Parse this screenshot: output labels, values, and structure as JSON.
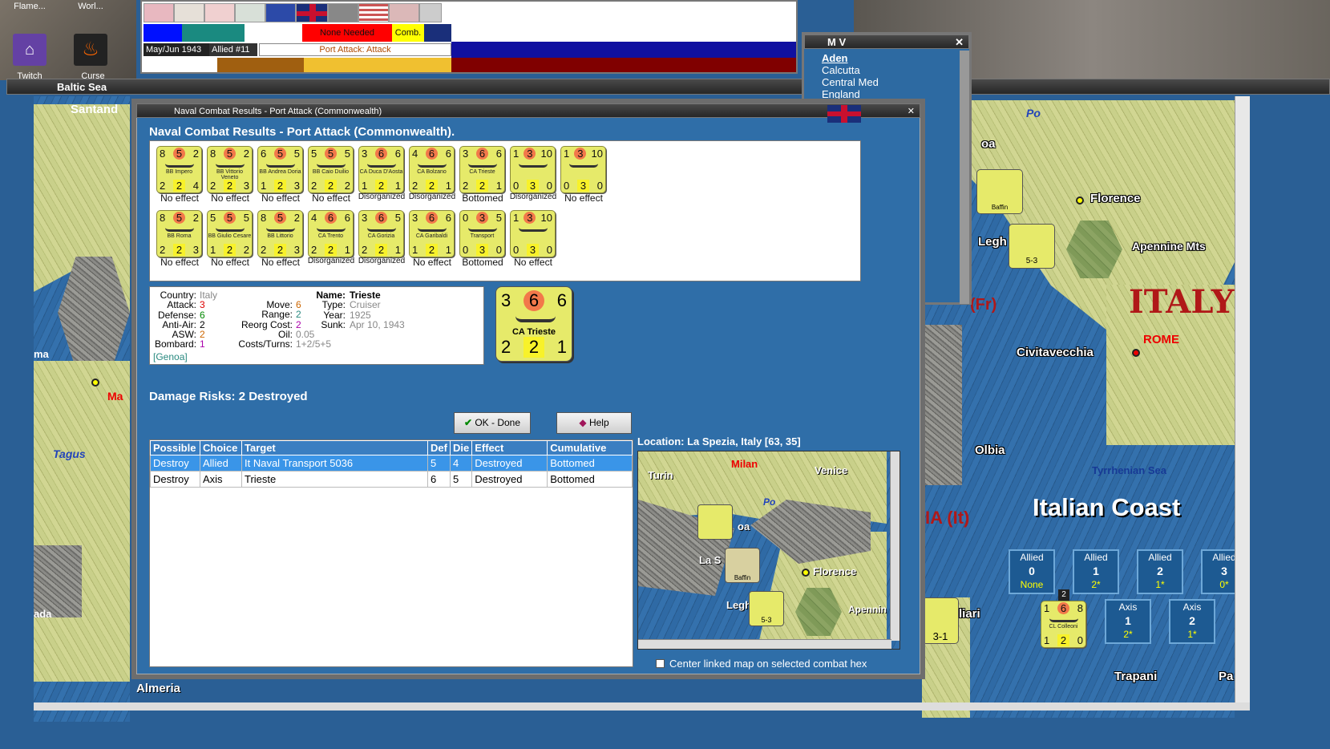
{
  "desktop": {
    "icons": [
      {
        "label": "Flame..."
      },
      {
        "label": "Worl..."
      },
      {
        "label": "Twitch"
      },
      {
        "label": "Curse Client"
      }
    ]
  },
  "top_bar": {
    "status_none": "None Needed",
    "status_comb": "Comb.",
    "date": "May/Jun 1943",
    "turn": "Allied #11",
    "phase": "Port Attack: Attack"
  },
  "mv_window": {
    "title": "M V",
    "items": [
      "Aden",
      "Calcutta",
      "Central Med",
      "England"
    ]
  },
  "baltic_window": {
    "title": "Baltic Sea"
  },
  "left_map": {
    "labels": [
      "Santand",
      "Tagus",
      "Ma",
      "ma",
      "ada",
      "Almeria"
    ]
  },
  "dialog": {
    "window_title": "Naval Combat Results - Port Attack (Commonwealth)",
    "header": "Naval Combat Results - Port Attack (Commonwealth).",
    "row1": [
      {
        "a": "8",
        "b": "5",
        "c": "2",
        "d": "2",
        "e": "2",
        "f": "4",
        "name": "BB Impero",
        "result": "No effect"
      },
      {
        "a": "8",
        "b": "5",
        "c": "2",
        "d": "2",
        "e": "2",
        "f": "3",
        "name": "BB Vittorio Veneto",
        "result": "No effect"
      },
      {
        "a": "6",
        "b": "5",
        "c": "5",
        "d": "1",
        "e": "2",
        "f": "3",
        "name": "BB Andrea Doria",
        "result": "No effect"
      },
      {
        "a": "5",
        "b": "5",
        "c": "5",
        "d": "2",
        "e": "2",
        "f": "2",
        "name": "BB Caio Duilio",
        "result": "No effect"
      },
      {
        "a": "3",
        "b": "6",
        "c": "6",
        "d": "1",
        "e": "2",
        "f": "1",
        "name": "CA Duca D'Aosta",
        "result": "Disorganized"
      },
      {
        "a": "4",
        "b": "6",
        "c": "6",
        "d": "2",
        "e": "2",
        "f": "1",
        "name": "CA Bolzano",
        "result": "Disorganized"
      },
      {
        "a": "3",
        "b": "6",
        "c": "6",
        "d": "2",
        "e": "2",
        "f": "1",
        "name": "CA Trieste",
        "result": "Bottomed"
      },
      {
        "a": "1",
        "b": "3",
        "c": "10",
        "d": "0",
        "e": "3",
        "f": "0",
        "name": "",
        "result": "Disorganized"
      },
      {
        "a": "1",
        "b": "3",
        "c": "10",
        "d": "0",
        "e": "3",
        "f": "0",
        "name": "",
        "result": "No effect"
      }
    ],
    "row2": [
      {
        "a": "8",
        "b": "5",
        "c": "2",
        "d": "2",
        "e": "2",
        "f": "3",
        "name": "BB Roma",
        "result": "No effect"
      },
      {
        "a": "5",
        "b": "5",
        "c": "5",
        "d": "1",
        "e": "2",
        "f": "2",
        "name": "BB Giulio Cesare",
        "result": "No effect"
      },
      {
        "a": "8",
        "b": "5",
        "c": "2",
        "d": "2",
        "e": "2",
        "f": "3",
        "name": "BB Littorio",
        "result": "No effect"
      },
      {
        "a": "4",
        "b": "6",
        "c": "6",
        "d": "2",
        "e": "2",
        "f": "1",
        "name": "CA Trento",
        "result": "Disorganized"
      },
      {
        "a": "3",
        "b": "6",
        "c": "5",
        "d": "2",
        "e": "2",
        "f": "1",
        "name": "CA Gorizia",
        "result": "Disorganized"
      },
      {
        "a": "3",
        "b": "6",
        "c": "6",
        "d": "1",
        "e": "2",
        "f": "1",
        "name": "CA Garibaldi",
        "result": "No effect"
      },
      {
        "a": "0",
        "b": "3",
        "c": "5",
        "d": "0",
        "e": "3",
        "f": "0",
        "name": "Transport",
        "result": "Bottomed"
      },
      {
        "a": "1",
        "b": "3",
        "c": "10",
        "d": "0",
        "e": "3",
        "f": "0",
        "name": "",
        "result": "No effect"
      }
    ],
    "details": {
      "country_label": "Country:",
      "country": "Italy",
      "attack_label": "Attack:",
      "attack": "3",
      "defense_label": "Defense:",
      "defense": "6",
      "aa_label": "Anti-Air:",
      "aa": "2",
      "asw_label": "ASW:",
      "asw": "2",
      "bombard_label": "Bombard:",
      "bombard": "1",
      "port": "[Genoa]",
      "move_label": "Move:",
      "move": "6",
      "range_label": "Range:",
      "range": "2",
      "reorg_label": "Reorg Cost:",
      "reorg": "2",
      "oil_label": "Oil:",
      "oil": "0.05",
      "costs_label": "Costs/Turns:",
      "costs": "1+2/5+5",
      "name_label": "Name:",
      "name": "Trieste",
      "type_label": "Type:",
      "type": "Cruiser",
      "year_label": "Year:",
      "year": "1925",
      "sunk_label": "Sunk:",
      "sunk": "Apr 10, 1943"
    },
    "big_counter": {
      "a": "3",
      "b": "6",
      "c": "6",
      "d": "2",
      "e": "2",
      "f": "1",
      "name": "CA Trieste"
    },
    "damage": "Damage Risks:  2 Destroyed",
    "ok_label": "OK - Done",
    "help_label": "Help",
    "table": {
      "headers": [
        "Possible",
        "Choice",
        "Target",
        "Def",
        "Die",
        "Effect",
        "Cumulative"
      ],
      "rows": [
        [
          "Destroy",
          "Allied",
          "It Naval Transport 5036",
          "5",
          "4",
          "Destroyed",
          "Bottomed"
        ],
        [
          "Destroy",
          "Axis",
          "Trieste",
          "6",
          "5",
          "Destroyed",
          "Bottomed"
        ]
      ]
    },
    "location": "Location:  La Spezia, Italy [63, 35]",
    "minimap": {
      "labels": [
        "Turin",
        "Milan",
        "Venice",
        "Po",
        "oa",
        "La S",
        "Florence",
        "Legh",
        "Apennin"
      ],
      "counter1": "Baffin",
      "counter2": "5-3"
    },
    "center_label": "Center linked map on selected combat hex"
  },
  "right_map": {
    "cities": [
      "Florence",
      "Apennine Mts",
      "ITALY",
      "ROME",
      "Civitavecchia",
      "Olbia",
      "Tyrrhenian Sea",
      "Italian Coast",
      "(Fr)",
      "IA (It)",
      "Legh",
      "liari",
      "Trapani",
      "Pa",
      "Po",
      "oa",
      "Baffin",
      "5-3",
      "3-1"
    ],
    "boxes": [
      {
        "side": "Allied",
        "num": "0",
        "sub": "None"
      },
      {
        "side": "Allied",
        "num": "1",
        "sub": "2*"
      },
      {
        "side": "Allied",
        "num": "2",
        "sub": "1*"
      },
      {
        "side": "Allied",
        "num": "3",
        "sub": "0*"
      },
      {
        "side": "Axis",
        "num": "1",
        "sub": "2*"
      },
      {
        "side": "Axis",
        "num": "2",
        "sub": "1*"
      }
    ],
    "colleoni": {
      "a": "1",
      "b": "6",
      "c": "8",
      "d": "1",
      "e": "2",
      "f": "0",
      "name": "CL Colleoni",
      "stack": "2"
    }
  }
}
